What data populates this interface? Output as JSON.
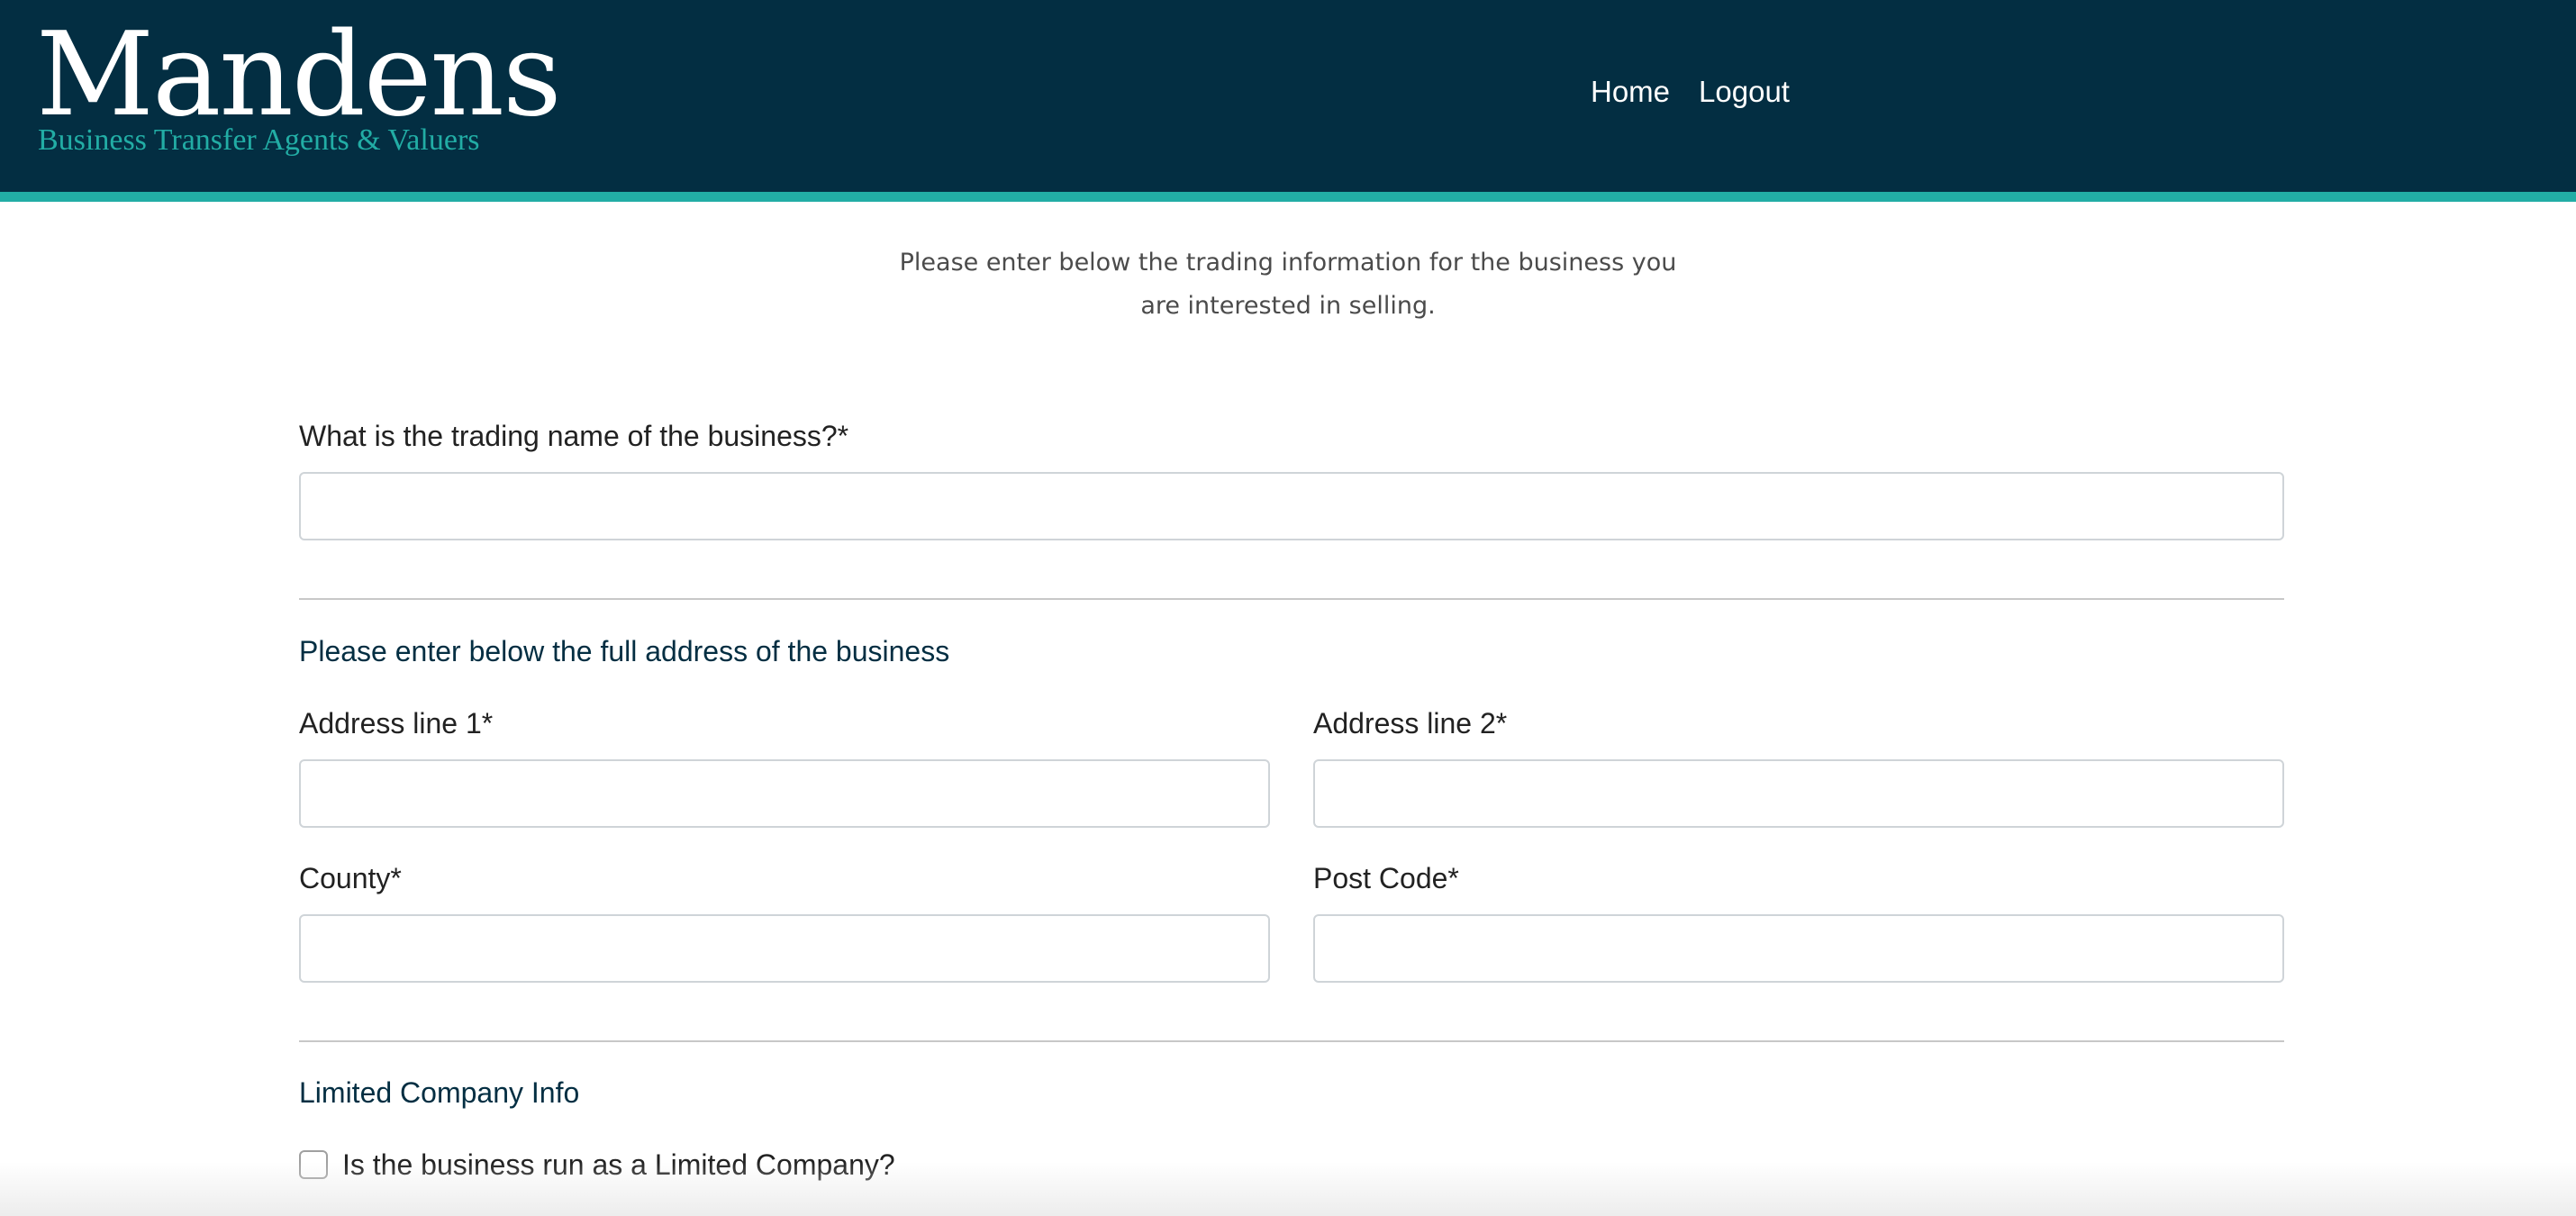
{
  "header": {
    "logo_title": "Mandens",
    "logo_subtitle": "Business Transfer Agents & Valuers",
    "nav": {
      "home": "Home",
      "logout": "Logout"
    }
  },
  "intro": {
    "line1": "Please enter below the trading information for the business you",
    "line2": "are interested in selling."
  },
  "form": {
    "trading_name_label": "What is the trading name of the business?*",
    "trading_name_value": "",
    "address_section_title": "Please enter below the full address of the business",
    "address_line1_label": "Address line 1*",
    "address_line1_value": "",
    "address_line2_label": "Address line 2*",
    "address_line2_value": "",
    "county_label": "County*",
    "county_value": "",
    "postcode_label": "Post Code*",
    "postcode_value": "",
    "limited_section_title": "Limited Company Info",
    "limited_checkbox_label": "Is the business run as a Limited Company?",
    "limited_checked": false
  },
  "colors": {
    "header_bg": "#032e42",
    "accent": "#22ada5",
    "section_title": "#032e42"
  }
}
